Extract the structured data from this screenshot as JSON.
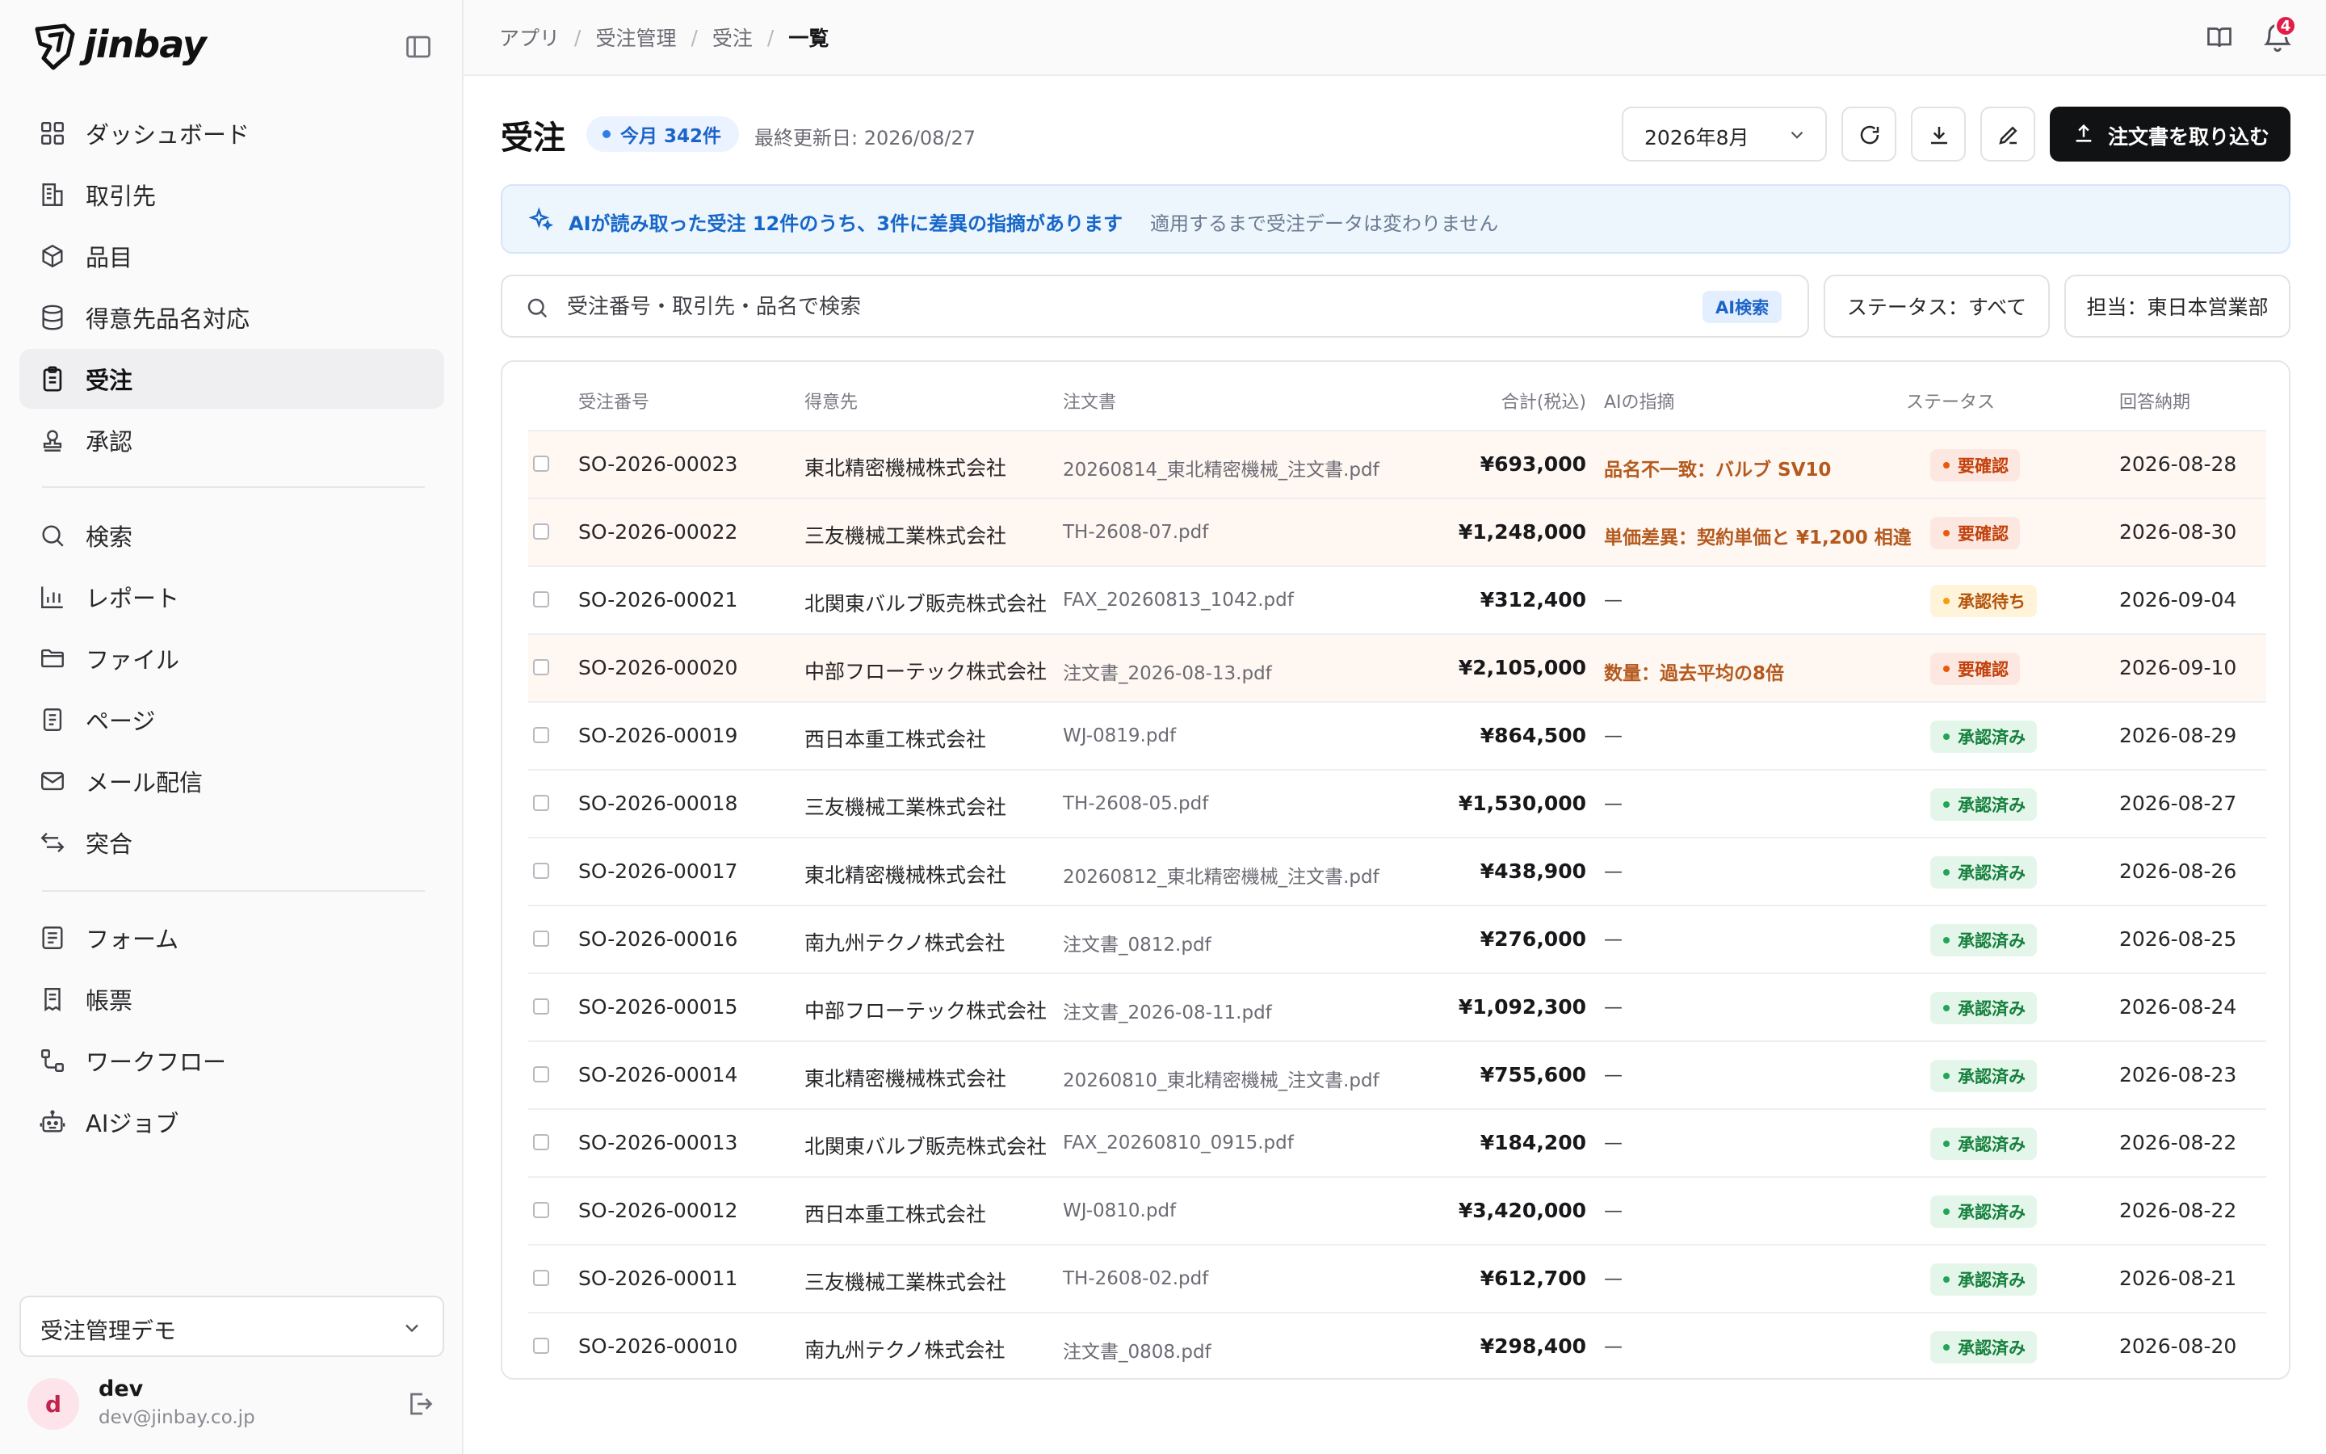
{
  "app": {
    "logo_text": "jinbay"
  },
  "sidebar": {
    "items": [
      {
        "label": "ダッシュボード",
        "icon": "grid-icon"
      },
      {
        "label": "取引先",
        "icon": "building-icon"
      },
      {
        "label": "品目",
        "icon": "box-icon"
      },
      {
        "label": "得意先品名対応",
        "icon": "database-icon"
      },
      {
        "label": "受注",
        "icon": "clipboard-icon",
        "active": true
      },
      {
        "label": "承認",
        "icon": "stamp-icon"
      },
      {
        "label": "検索",
        "icon": "search-icon"
      },
      {
        "label": "レポート",
        "icon": "bar-chart-icon"
      },
      {
        "label": "ファイル",
        "icon": "folder-icon"
      },
      {
        "label": "ページ",
        "icon": "page-icon"
      },
      {
        "label": "メール配信",
        "icon": "mail-icon"
      },
      {
        "label": "突合",
        "icon": "swap-icon"
      },
      {
        "label": "フォーム",
        "icon": "form-icon"
      },
      {
        "label": "帳票",
        "icon": "receipt-icon"
      },
      {
        "label": "ワークフロー",
        "icon": "workflow-icon"
      },
      {
        "label": "AIジョブ",
        "icon": "robot-icon"
      }
    ],
    "workspace": "受注管理デモ",
    "user": {
      "initial": "d",
      "name": "dev",
      "email": "dev@jinbay.co.jp"
    }
  },
  "topbar": {
    "breadcrumb": [
      "アプリ",
      "受注管理",
      "受注",
      "一覧"
    ],
    "notification_count": "4"
  },
  "header": {
    "title": "受注",
    "badge": "今月 342件",
    "last_updated": "最終更新日: 2026/08/27",
    "month": "2026年8月",
    "import_label": "注文書を取り込む"
  },
  "banner": {
    "main": "AIが読み取った受注 12件のうち、3件に差異の指摘があります",
    "sub": "適用するまで受注データは変わりません"
  },
  "search": {
    "placeholder": "受注番号・取引先・品名で検索",
    "ai_tag": "AI検索",
    "status_filter": "ステータス：すべて",
    "owner_filter": "担当：東日本営業部"
  },
  "table": {
    "columns": [
      "受注番号",
      "得意先",
      "注文書",
      "合計(税込)",
      "AIの指摘",
      "ステータス",
      "回答納期"
    ],
    "rows": [
      {
        "id": "SO-2026-00023",
        "customer": "東北精密機械株式会社",
        "file": "20260814_東北精密機械_注文書.pdf",
        "amount": "¥693,000",
        "ai": "品名不一致：バルブ SV10",
        "status": "要確認",
        "date": "2026-08-28"
      },
      {
        "id": "SO-2026-00022",
        "customer": "三友機械工業株式会社",
        "file": "TH-2608-07.pdf",
        "amount": "¥1,248,000",
        "ai": "単価差異：契約単価と ¥1,200 相違",
        "status": "要確認",
        "date": "2026-08-30"
      },
      {
        "id": "SO-2026-00021",
        "customer": "北関東バルブ販売株式会社",
        "file": "FAX_20260813_1042.pdf",
        "amount": "¥312,400",
        "ai": "—",
        "status": "承認待ち",
        "date": "2026-09-04"
      },
      {
        "id": "SO-2026-00020",
        "customer": "中部フローテック株式会社",
        "file": "注文書_2026-08-13.pdf",
        "amount": "¥2,105,000",
        "ai": "数量：過去平均の8倍",
        "status": "要確認",
        "date": "2026-09-10"
      },
      {
        "id": "SO-2026-00019",
        "customer": "西日本重工株式会社",
        "file": "WJ-0819.pdf",
        "amount": "¥864,500",
        "ai": "—",
        "status": "承認済み",
        "date": "2026-08-29"
      },
      {
        "id": "SO-2026-00018",
        "customer": "三友機械工業株式会社",
        "file": "TH-2608-05.pdf",
        "amount": "¥1,530,000",
        "ai": "—",
        "status": "承認済み",
        "date": "2026-08-27"
      },
      {
        "id": "SO-2026-00017",
        "customer": "東北精密機械株式会社",
        "file": "20260812_東北精密機械_注文書.pdf",
        "amount": "¥438,900",
        "ai": "—",
        "status": "承認済み",
        "date": "2026-08-26"
      },
      {
        "id": "SO-2026-00016",
        "customer": "南九州テクノ株式会社",
        "file": "注文書_0812.pdf",
        "amount": "¥276,000",
        "ai": "—",
        "status": "承認済み",
        "date": "2026-08-25"
      },
      {
        "id": "SO-2026-00015",
        "customer": "中部フローテック株式会社",
        "file": "注文書_2026-08-11.pdf",
        "amount": "¥1,092,300",
        "ai": "—",
        "status": "承認済み",
        "date": "2026-08-24"
      },
      {
        "id": "SO-2026-00014",
        "customer": "東北精密機械株式会社",
        "file": "20260810_東北精密機械_注文書.pdf",
        "amount": "¥755,600",
        "ai": "—",
        "status": "承認済み",
        "date": "2026-08-23"
      },
      {
        "id": "SO-2026-00013",
        "customer": "北関東バルブ販売株式会社",
        "file": "FAX_20260810_0915.pdf",
        "amount": "¥184,200",
        "ai": "—",
        "status": "承認済み",
        "date": "2026-08-22"
      },
      {
        "id": "SO-2026-00012",
        "customer": "西日本重工株式会社",
        "file": "WJ-0810.pdf",
        "amount": "¥3,420,000",
        "ai": "—",
        "status": "承認済み",
        "date": "2026-08-22"
      },
      {
        "id": "SO-2026-00011",
        "customer": "三友機械工業株式会社",
        "file": "TH-2608-02.pdf",
        "amount": "¥612,700",
        "ai": "—",
        "status": "承認済み",
        "date": "2026-08-21"
      },
      {
        "id": "SO-2026-00010",
        "customer": "南九州テクノ株式会社",
        "file": "注文書_0808.pdf",
        "amount": "¥298,400",
        "ai": "—",
        "status": "承認済み",
        "date": "2026-08-20"
      }
    ]
  }
}
